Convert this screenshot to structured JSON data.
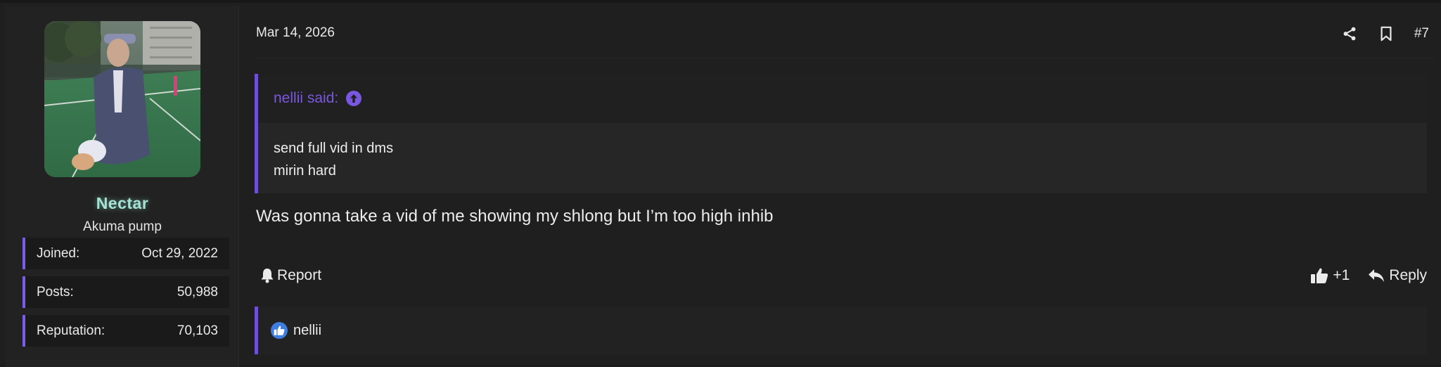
{
  "user": {
    "name": "Nectar",
    "title": "Akuma pump",
    "stats": [
      {
        "label": "Joined:",
        "value": "Oct 29, 2022"
      },
      {
        "label": "Posts:",
        "value": "50,988"
      },
      {
        "label": "Reputation:",
        "value": "70,103"
      }
    ]
  },
  "post": {
    "date": "Mar 14, 2026",
    "number": "#7",
    "quote": {
      "author": "nellii said:",
      "lines": [
        "send full vid in dms",
        "mirin hard"
      ]
    },
    "message": "Was gonna take a vid of me showing my shlong but I’m too high inhib",
    "actions": {
      "report": "Report",
      "like_count": "+1",
      "reply": "Reply"
    },
    "reactions": {
      "users": [
        "nellii"
      ]
    }
  },
  "icons": {
    "share": "share-icon",
    "bookmark": "bookmark-icon",
    "quote_jump": "arrow-up-circle-icon",
    "report": "bell-icon",
    "like": "thumbs-up-icon",
    "reply": "reply-arrow-icon",
    "reaction": "thumbs-up-badge-icon"
  },
  "colors": {
    "accent": "#6f4fd8",
    "username": "#a6e3d3",
    "quote_author": "#7a57e0",
    "reaction_badge": "#3f7de0"
  }
}
